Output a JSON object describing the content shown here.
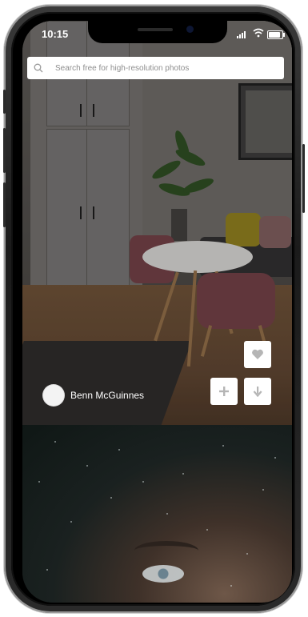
{
  "status_bar": {
    "time": "10:15",
    "battery_level": 0.85
  },
  "search": {
    "placeholder": "Search free for high-resolution photos",
    "icon": "search-icon"
  },
  "photos": [
    {
      "author": "Benn McGuinnes",
      "actions": {
        "like_icon": "heart-icon",
        "add_icon": "plus-icon",
        "download_icon": "arrow-down-icon"
      }
    },
    {}
  ],
  "colors": {
    "button_bg": "#ffffff",
    "icon_gray": "#b5b5b5",
    "text_white": "#ffffff"
  }
}
